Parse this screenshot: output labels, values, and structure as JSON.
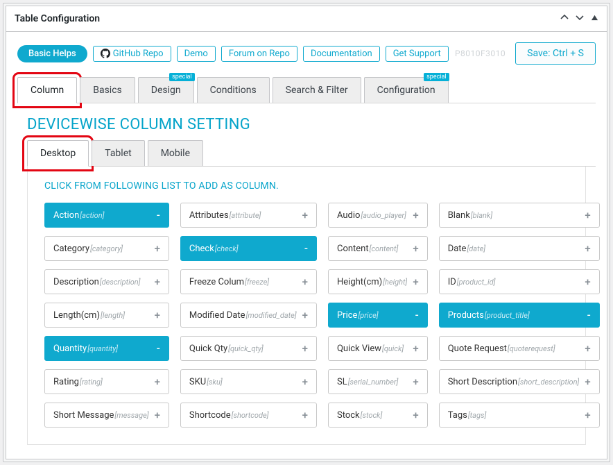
{
  "panel": {
    "title": "Table Configuration"
  },
  "helpLinks": {
    "basic": "Basic Helps",
    "github": "GitHub Repo",
    "demo": "Demo",
    "forum": "Forum on Repo",
    "docs": "Documentation",
    "support": "Get Support"
  },
  "right": {
    "code": "P8010F3010",
    "save": "Save: Ctrl + S"
  },
  "mainTabs": {
    "column": "Column",
    "basics": "Basics",
    "design": "Design",
    "conditions": "Conditions",
    "search": "Search & Filter",
    "configuration": "Configuration",
    "badge": "special"
  },
  "subTitle": "DEVICEWISE COLUMN SETTING",
  "deviceTabs": {
    "desktop": "Desktop",
    "tablet": "Tablet",
    "mobile": "Mobile"
  },
  "pickerCaption": "CLICK FROM FOLLOWING LIST TO ADD AS COLUMN.",
  "columns": [
    {
      "label": "Action",
      "slug": "[action]",
      "selected": true
    },
    {
      "label": "Attributes",
      "slug": "[attribute]",
      "selected": false
    },
    {
      "label": "Audio",
      "slug": "[audio_player]",
      "selected": false
    },
    {
      "label": "Blank",
      "slug": "[blank]",
      "selected": false
    },
    {
      "label": "Category",
      "slug": "[category]",
      "selected": false
    },
    {
      "label": "Check",
      "slug": "[check]",
      "selected": true
    },
    {
      "label": "Content",
      "slug": "[content]",
      "selected": false
    },
    {
      "label": "Date",
      "slug": "[date]",
      "selected": false
    },
    {
      "label": "Description",
      "slug": "[description]",
      "selected": false
    },
    {
      "label": "Freeze Colum",
      "slug": "[freeze]",
      "selected": false
    },
    {
      "label": "Height(cm)",
      "slug": "[height]",
      "selected": false
    },
    {
      "label": "ID",
      "slug": "[product_id]",
      "selected": false
    },
    {
      "label": "Length(cm)",
      "slug": "[length]",
      "selected": false
    },
    {
      "label": "Modified Date",
      "slug": "[modified_date]",
      "selected": false
    },
    {
      "label": "Price",
      "slug": "[price]",
      "selected": true
    },
    {
      "label": "Products",
      "slug": "[product_title]",
      "selected": true
    },
    {
      "label": "Quantity",
      "slug": "[quantity]",
      "selected": true
    },
    {
      "label": "Quick Qty",
      "slug": "[quick_qty]",
      "selected": false
    },
    {
      "label": "Quick View",
      "slug": "[quick]",
      "selected": false
    },
    {
      "label": "Quote Request",
      "slug": "[quoterequest]",
      "selected": false
    },
    {
      "label": "Rating",
      "slug": "[rating]",
      "selected": false
    },
    {
      "label": "SKU",
      "slug": "[sku]",
      "selected": false
    },
    {
      "label": "SL",
      "slug": "[serial_number]",
      "selected": false
    },
    {
      "label": "Short Description",
      "slug": "[short_description]",
      "selected": false
    },
    {
      "label": "Short Message",
      "slug": "[message]",
      "selected": false
    },
    {
      "label": "Shortcode",
      "slug": "[shortcode]",
      "selected": false
    },
    {
      "label": "Stock",
      "slug": "[stock]",
      "selected": false
    },
    {
      "label": "Tags",
      "slug": "[tags]",
      "selected": false
    }
  ]
}
